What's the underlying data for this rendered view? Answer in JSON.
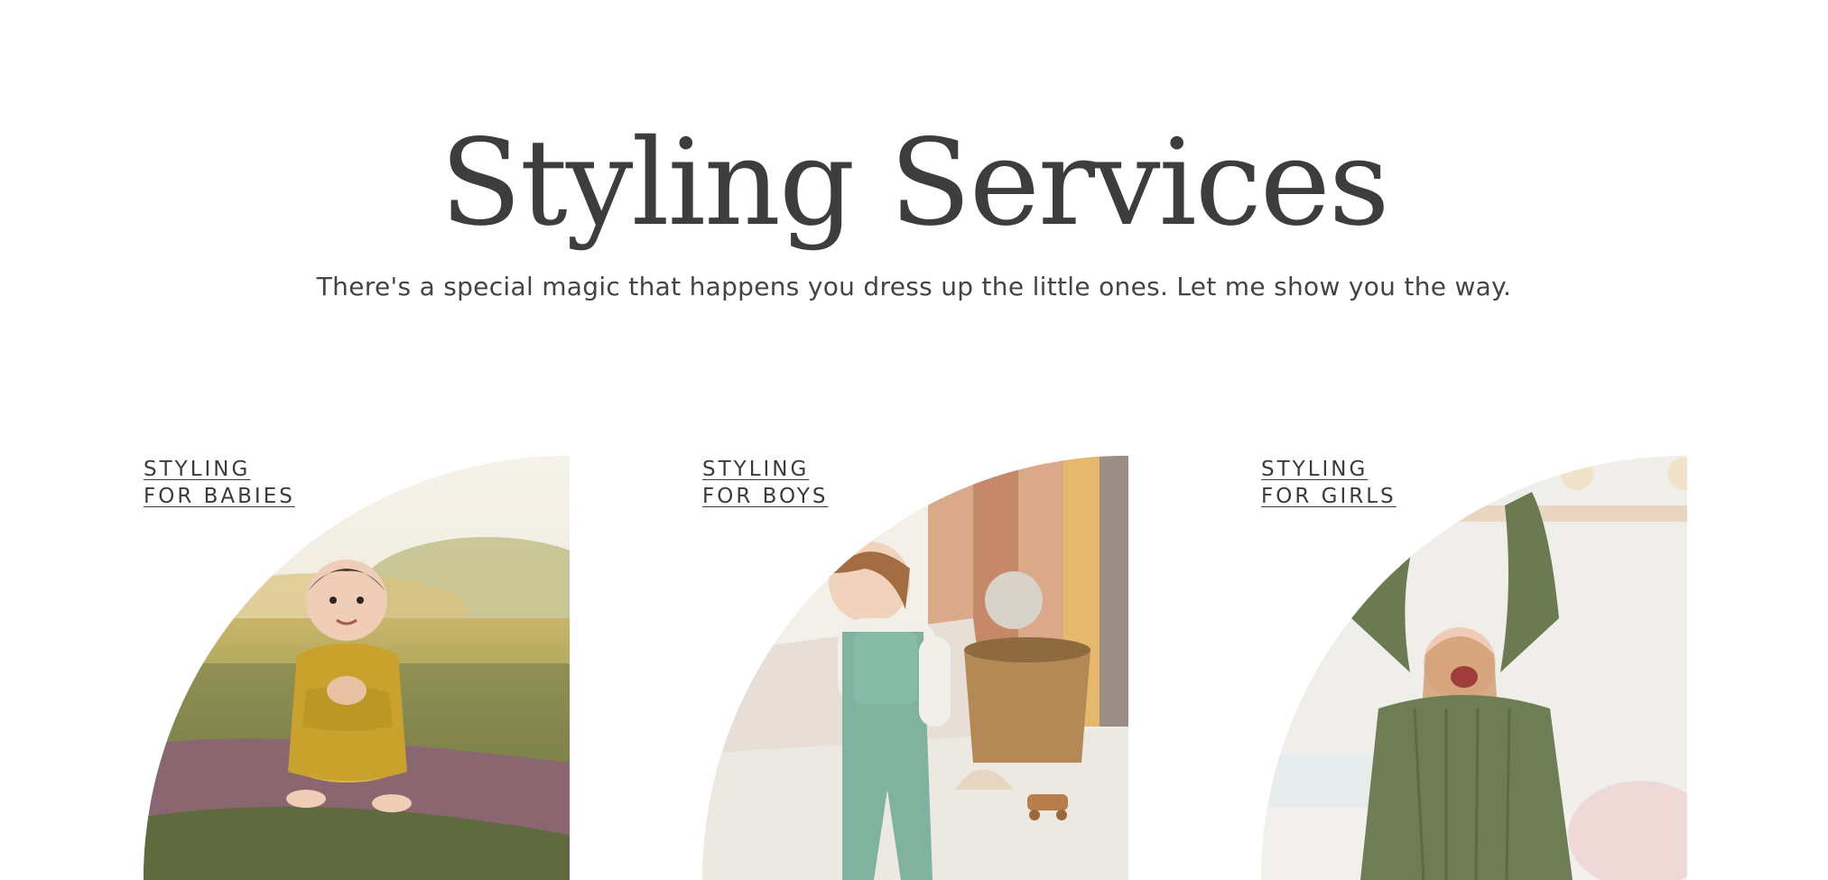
{
  "section": {
    "title": "Styling Services",
    "subtitle": "There's a special magic that happens you dress up the little ones. Let me show you the way."
  },
  "cards": [
    {
      "line1": "STYLING",
      "line2": "FOR BABIES",
      "image": "baby-on-picnic-blanket-photo"
    },
    {
      "line1": "STYLING",
      "line2": "FOR BOYS",
      "image": "toddler-boy-walking-photo"
    },
    {
      "line1": "STYLING",
      "line2": "FOR GIRLS",
      "image": "girl-arms-raised-photo"
    }
  ],
  "colors": {
    "text": "#3d3d3d",
    "background": "#ffffff"
  }
}
